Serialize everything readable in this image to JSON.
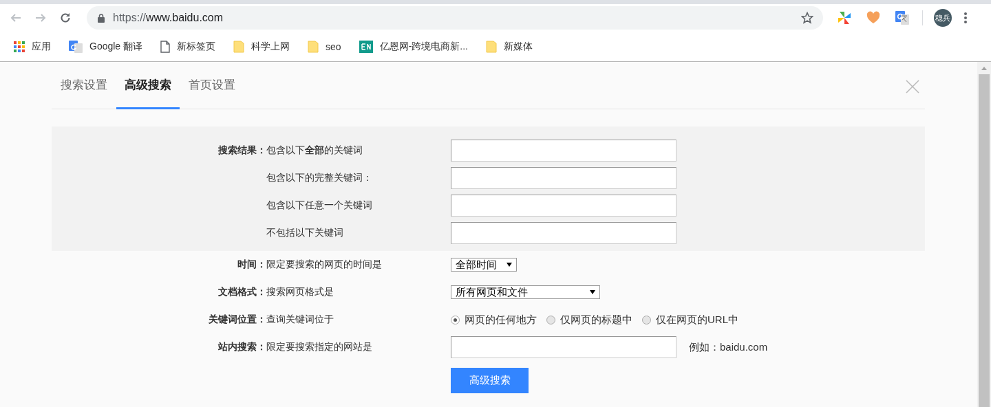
{
  "browser": {
    "url_scheme": "https://",
    "url_host": "www.baidu.com",
    "profile_initials": "稳兵"
  },
  "bookmarks": [
    {
      "kind": "apps",
      "label": "应用"
    },
    {
      "kind": "translate",
      "label": "Google 翻译"
    },
    {
      "kind": "page",
      "label": "新标签页"
    },
    {
      "kind": "folder",
      "label": "科学上网"
    },
    {
      "kind": "folder",
      "label": "seo"
    },
    {
      "kind": "site",
      "label": "亿恩网-跨境电商新..."
    },
    {
      "kind": "folder",
      "label": "新媒体"
    }
  ],
  "tabs": [
    {
      "label": "搜索设置",
      "selected": false
    },
    {
      "label": "高级搜索",
      "selected": true
    },
    {
      "label": "首页设置",
      "selected": false
    }
  ],
  "keyword_group": {
    "label": "搜索结果：",
    "rows": [
      {
        "description": "包含以下**全部**的关键词"
      },
      {
        "description": "包含以下的完整关键词："
      },
      {
        "description": "包含以下任意一个关键词"
      },
      {
        "description": "不包括以下关键词"
      }
    ]
  },
  "options": [
    {
      "kind": "select",
      "label": "时间：",
      "description": "限定要搜索的网页的时间是",
      "value": "全部时间"
    },
    {
      "kind": "select",
      "label": "文档格式：",
      "description": "搜索网页格式是",
      "value": "所有网页和文件"
    },
    {
      "kind": "radio",
      "label": "关键词位置：",
      "description": "查询关键词位于",
      "choices": [
        {
          "label": "网页的任何地方",
          "selected": true
        },
        {
          "label": "仅网页的标题中",
          "selected": false
        },
        {
          "label": "仅在网页的URL中",
          "selected": false
        }
      ]
    },
    {
      "kind": "text",
      "label": "站内搜索：",
      "description": "限定要搜索指定的网站是",
      "hint": "例如：baidu.com"
    }
  ],
  "submit_button": "高级搜索"
}
